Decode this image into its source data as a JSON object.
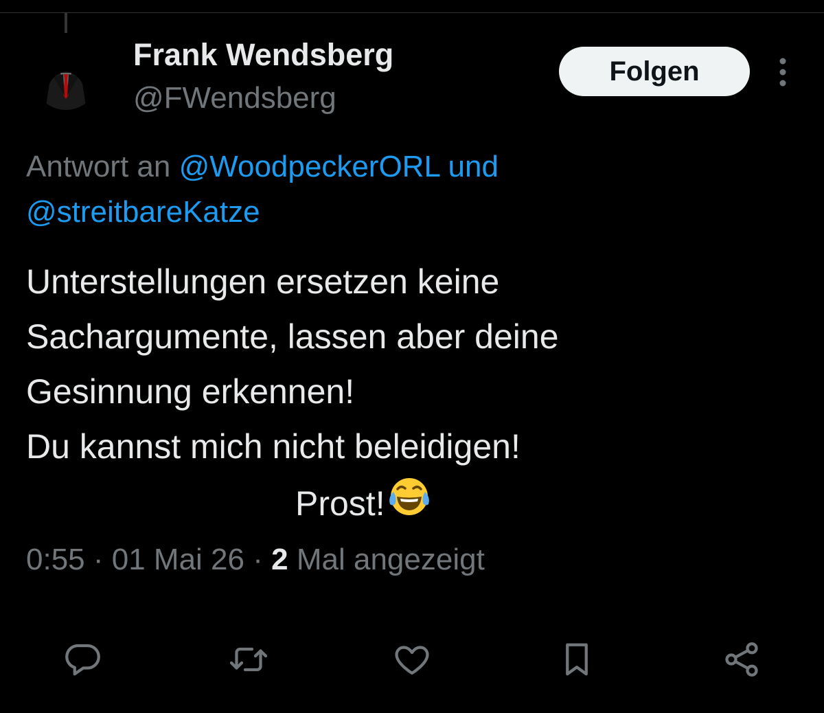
{
  "author": {
    "display_name": "Frank Wendsberg",
    "handle": "@FWendsberg"
  },
  "follow_button": {
    "label": "Folgen"
  },
  "reply_context": {
    "prefix": "Antwort an",
    "mention_1": "@WoodpeckerORL",
    "conjunction": "und",
    "mention_2": "@streitbareKatze"
  },
  "tweet": {
    "lines": [
      "Unterstellungen ersetzen keine",
      "Sachargumente, lassen aber deine",
      "Gesinnung erkennen!",
      "Du kannst mich nicht beleidigen!",
      "Prost!"
    ],
    "emoji": "face-with-tears-of-joy"
  },
  "meta": {
    "time": "0:55",
    "separator": "·",
    "date": "01 Mai 26",
    "views_count": "2",
    "views_label": "Mal angezeigt"
  },
  "actions": {
    "icons": [
      "reply-icon",
      "retweet-icon",
      "like-icon",
      "bookmark-icon",
      "share-icon"
    ]
  },
  "colors": {
    "background": "#000000",
    "primary_text": "#e7e9ea",
    "secondary_text": "#71767b",
    "link": "#1d9bf0",
    "button_bg": "#eff3f4",
    "button_text": "#0f1419"
  }
}
